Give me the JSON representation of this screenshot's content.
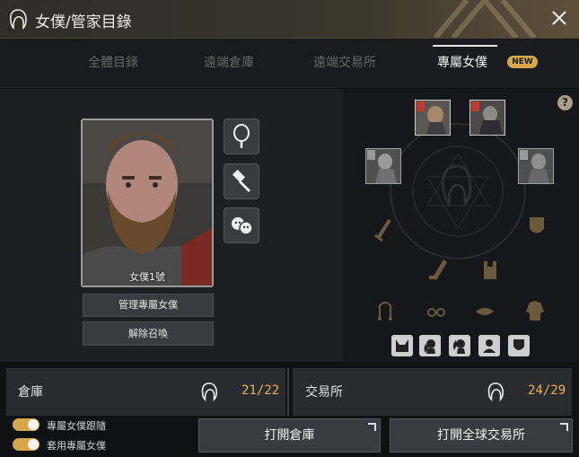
{
  "window": {
    "title": "女僕/管家目錄",
    "close_icon": "close-icon",
    "logo_icon": "maid-head-icon"
  },
  "tabs": [
    {
      "label": "全體目錄",
      "active": false
    },
    {
      "label": "遠端倉庫",
      "active": false
    },
    {
      "label": "遠端交易所",
      "active": false
    },
    {
      "label": "專屬女僕",
      "active": true,
      "badge": "NEW"
    }
  ],
  "portrait": {
    "name_label": "女僕1號"
  },
  "side_buttons": [
    "mirror-icon",
    "hammer-icon",
    "emotes-icon"
  ],
  "actions": {
    "manage_label": "管理專屬女僕",
    "dismiss_label": "解除召喚"
  },
  "help": {
    "label": "?"
  },
  "equipment": {
    "slots": [
      "maid-slot-1",
      "maid-slot-2",
      "maid-slot-3",
      "maid-slot-4"
    ],
    "small_icons": [
      "cat-ears-icon",
      "ponytail-icon",
      "hair-icon",
      "bust-icon",
      "shield-icon"
    ]
  },
  "warehouse": {
    "label": "倉庫",
    "value": "21/22"
  },
  "market": {
    "label": "交易所",
    "value": "24/29"
  },
  "toggles": [
    {
      "label": "專屬女僕跟隨",
      "on": true
    },
    {
      "label": "套用專屬女僕",
      "on": true
    }
  ],
  "buttons": {
    "open_warehouse": "打開倉庫",
    "open_market": "打開全球交易所"
  },
  "colors": {
    "accent": "#d7a84a",
    "value": "#e7b547"
  }
}
